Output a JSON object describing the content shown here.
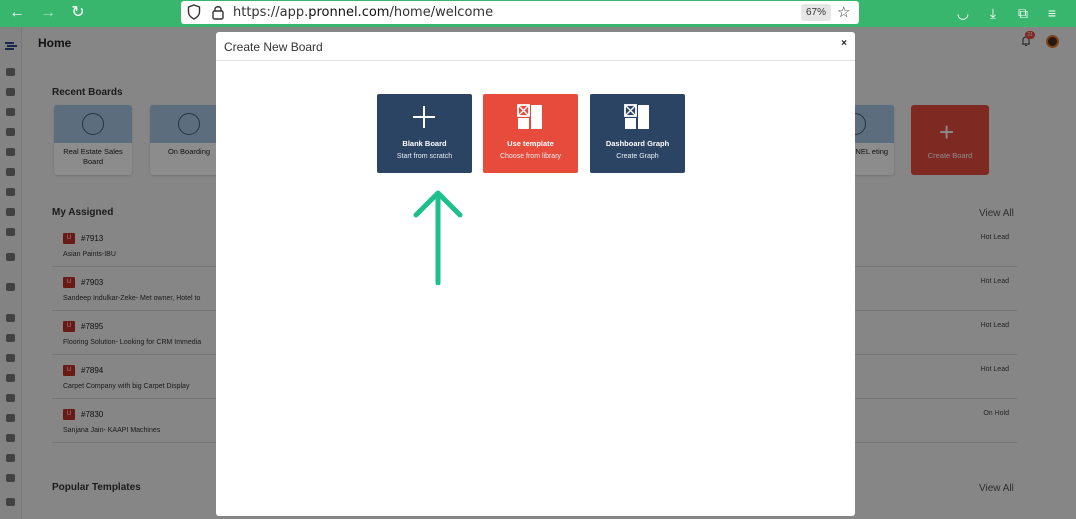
{
  "browser": {
    "url_prefix": "https://app.",
    "url_domain": "pronnel.com",
    "url_path": "/home/welcome",
    "zoom": "67%"
  },
  "app": {
    "page_title": "Home",
    "notification_count": "21",
    "recent_boards": {
      "title": "Recent Boards",
      "cards": [
        {
          "label": "Real Estate Sales Board"
        },
        {
          "label": "On Boarding"
        },
        {
          "label": "NNEL eting"
        }
      ],
      "create_label": "Create Board"
    },
    "my_assigned": {
      "title": "My Assigned",
      "view_all": "View All",
      "rows": [
        {
          "badge": "U",
          "number": "#7913",
          "desc": "Asian Paints-IBU",
          "status": "Hot Lead"
        },
        {
          "badge": "U",
          "number": "#7903",
          "desc": "Sandeep Indulkar-Zeke- Met owner, Hotel to",
          "status": "Hot Lead"
        },
        {
          "badge": "U",
          "number": "#7895",
          "desc": "Flooring Solution- Looking for CRM Immedia",
          "status": "Hot Lead"
        },
        {
          "badge": "U",
          "number": "#7894",
          "desc": "Carpet Company with big Carpet Display",
          "status": "Hot Lead"
        },
        {
          "badge": "U",
          "number": "#7830",
          "desc": "Sanjana Jain- KAAPI Machines",
          "status": "On Hold"
        }
      ]
    },
    "popular_templates": {
      "title": "Popular Templates",
      "view_all": "View All"
    }
  },
  "modal": {
    "title": "Create New Board",
    "close": "×",
    "options": [
      {
        "title": "Blank Board",
        "subtitle": "Start from scratch",
        "icon": "plus-icon",
        "color": "#2c4463"
      },
      {
        "title": "Use template",
        "subtitle": "Choose from library",
        "icon": "template-icon",
        "color": "#e64b3c"
      },
      {
        "title": "Dashboard Graph",
        "subtitle": "Create Graph",
        "icon": "graph-icon",
        "color": "#2c4463"
      }
    ]
  },
  "annotation": {
    "arrow_color": "#1dbf8a",
    "arrow_icon": "up-arrow-icon"
  }
}
